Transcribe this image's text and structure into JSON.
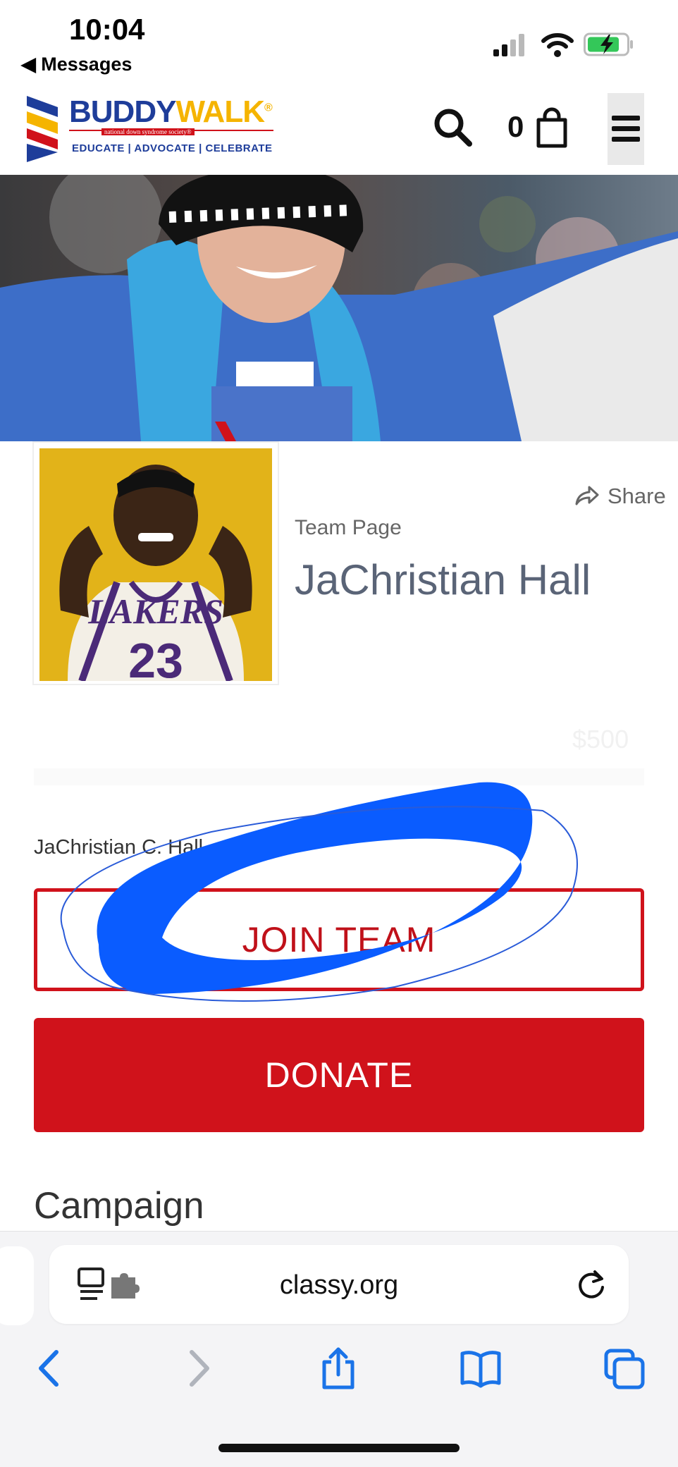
{
  "status_bar": {
    "time": "10:04",
    "back_label": "◀ Messages"
  },
  "header": {
    "logo": {
      "name_part1": "BUDDY",
      "name_part2": "WALK",
      "registered": "®",
      "tagline_small": "national down syndrome society®",
      "tagline": "EDUCATE | ADVOCATE | CELEBRATE"
    },
    "cart_count": "0",
    "icons": [
      "search-icon",
      "shopping-bag-icon",
      "hamburger-menu-icon"
    ]
  },
  "profile": {
    "share_label": "Share",
    "team_label": "Team Page",
    "team_name": "JaChristian Hall",
    "jersey_text": "LAKERS",
    "jersey_number": "23",
    "goal_amount": "$500",
    "member_name": "JaChristian C. Hall"
  },
  "actions": {
    "join_label": "JOIN TEAM",
    "donate_label": "DONATE"
  },
  "section": {
    "heading": "Campaign"
  },
  "browser": {
    "url": "classy.org",
    "toolbar_icons": [
      "back-arrow-icon",
      "forward-arrow-icon",
      "share-icon",
      "bookmarks-icon",
      "tabs-icon"
    ]
  },
  "colors": {
    "brand_red": "#d0121b",
    "brand_blue": "#1e3d9a",
    "brand_yellow": "#f5b400",
    "ios_blue": "#1a73e8",
    "scribble_blue": "#0a5cff"
  }
}
